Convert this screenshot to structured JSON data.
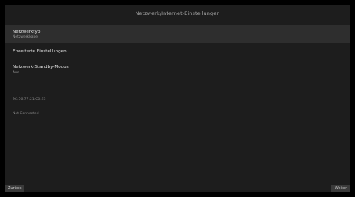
{
  "header": {
    "title": "Netzwerk/Internet-Einstellungen"
  },
  "menu": {
    "items": [
      {
        "label": "Netzwerktyp",
        "value": "Netzwerkkabel",
        "selected": true
      },
      {
        "label": "Erweiterte Einstellungen",
        "value": "",
        "selected": false
      },
      {
        "label": "Netzwerk-Standby-Modus",
        "value": "Aus",
        "selected": false
      }
    ]
  },
  "info": {
    "mac_address": "9C:56:77:21:C0:E3",
    "connection_status": "Not Connected"
  },
  "footer": {
    "back_label": "Zurück",
    "next_label": "Weiter"
  }
}
